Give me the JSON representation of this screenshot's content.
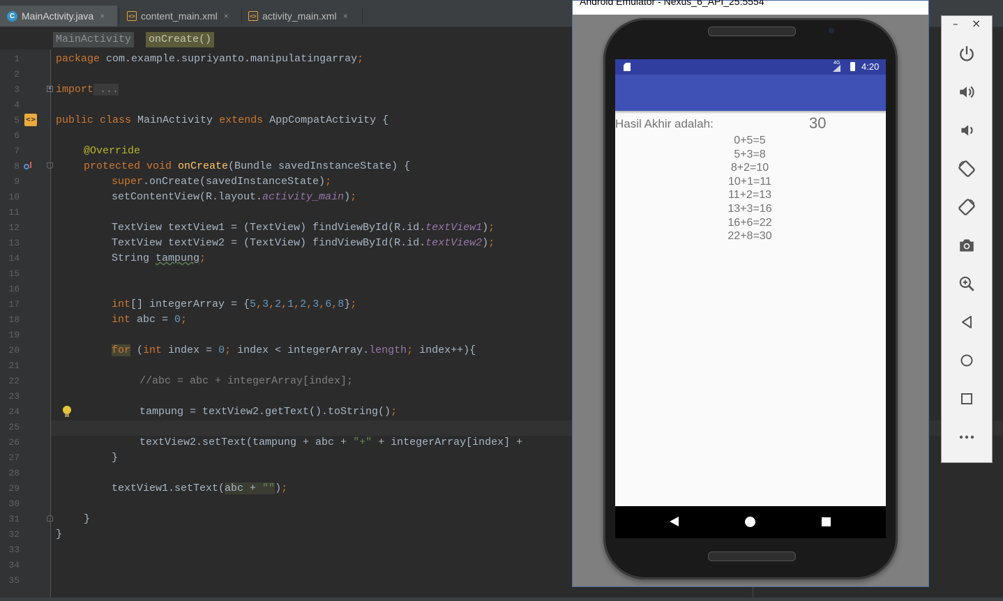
{
  "ide": {
    "tabs": [
      {
        "label": "MainActivity.java",
        "icon": "java-class-icon",
        "active": true
      },
      {
        "label": "content_main.xml",
        "icon": "xml-layout-icon",
        "active": false
      },
      {
        "label": "activity_main.xml",
        "icon": "xml-layout-icon",
        "active": false
      }
    ],
    "close_glyph": "×",
    "breadcrumb": [
      "MainActivity",
      "onCreate()"
    ],
    "code_lines": [
      "1",
      "2",
      "3",
      "4",
      "5",
      "6",
      "7",
      "8",
      "9",
      "10",
      "11",
      "12",
      "13",
      "14",
      "15",
      "16",
      "17",
      "18",
      "19",
      "20",
      "21",
      "22",
      "23",
      "24",
      "25",
      "26",
      "27",
      "28",
      "29",
      "30",
      "31",
      "32",
      "33",
      "34",
      "35"
    ],
    "code": {
      "l1_kw": "package",
      "l1_rest": " com.example.supriyanto.manipulatingarray",
      "semi": ";",
      "l3_kw": "import",
      "l3_fold": " ...",
      "l7_public": "public",
      "l7_class": " class",
      "l7_name": " MainActivity",
      "l7_extends": " extends",
      "l7_rest": " AppCompatActivity {",
      "l9": "@Override",
      "l10_mods": "protected void",
      "l10_fn": " onCreate",
      "l10_rest": "(Bundle savedInstanceState) {",
      "l11_super": "super",
      "l11_rest": ".onCreate(savedInstanceState)",
      "l12_a": "setContentView(R.layout.",
      "l12_f": "activity_main",
      "l12_b": ")",
      "l14_a": "TextView textView1 = (TextView) findViewById(R.id.",
      "l14_f": "textView1",
      "l15_a": "TextView textView2 = (TextView) findViewById(R.id.",
      "l15_f": "textView2",
      "paren_close": ")",
      "l16_a": "String ",
      "l16_b": "tampung",
      "l19_kw": "int",
      "l19_a": "[] integerArray = {",
      "l19_nums": [
        "5",
        "3",
        "2",
        "1",
        "2",
        "3",
        "6",
        "8"
      ],
      "comma": ",",
      "l19_end": "}",
      "l20_kw": "int",
      "l20_a": " abc = ",
      "l20_num": "0",
      "l22_for": "for",
      "l22_a": " (",
      "l22_int": "int",
      "l22_b": " index = ",
      "l22_num": "0",
      "l22_c": " index < integerArray.",
      "l22_len": "length",
      "l22_d": " index++){",
      "l24": "//abc = abc + integerArray[index];",
      "l26": "tampung = textView2.getText().toString()",
      "l28_a": "textView2.setText(tampung + abc + ",
      "l28_str": "\"+\"",
      "l28_b": " + integerArray[index] +",
      "l29": "}",
      "l31_a": "textView1.setText(",
      "l31_b": "abc + ",
      "l31_str": "\"\"",
      "l31_c": ")",
      "l33": "}",
      "l34": "}"
    }
  },
  "emulator": {
    "window_title": "Android Emulator - Nexus_6_API_25:5554",
    "status": {
      "network": "4G",
      "time": "4:20"
    },
    "app": {
      "label": "Hasil Akhir adalah:",
      "total": "30",
      "results": [
        "0+5=5",
        "5+3=8",
        "8+2=10",
        "10+1=11",
        "11+2=13",
        "13+3=16",
        "16+6=22",
        "22+8=30"
      ]
    },
    "nav": [
      "back",
      "home",
      "recents"
    ]
  },
  "side_toolbar": {
    "window_controls": {
      "minimize": "–",
      "close": "×"
    },
    "buttons": [
      "power",
      "volume-up",
      "volume-down",
      "rotate-left",
      "rotate-right",
      "screenshot",
      "zoom",
      "back",
      "home",
      "overview",
      "more"
    ]
  },
  "colors": {
    "ide_bg": "#2b2b2b",
    "keyword": "#cc7832",
    "string": "#6a8759",
    "number": "#6897bb",
    "field": "#9876aa",
    "app_primary": "#3f51b5",
    "app_primary_dark": "#303f9f"
  }
}
